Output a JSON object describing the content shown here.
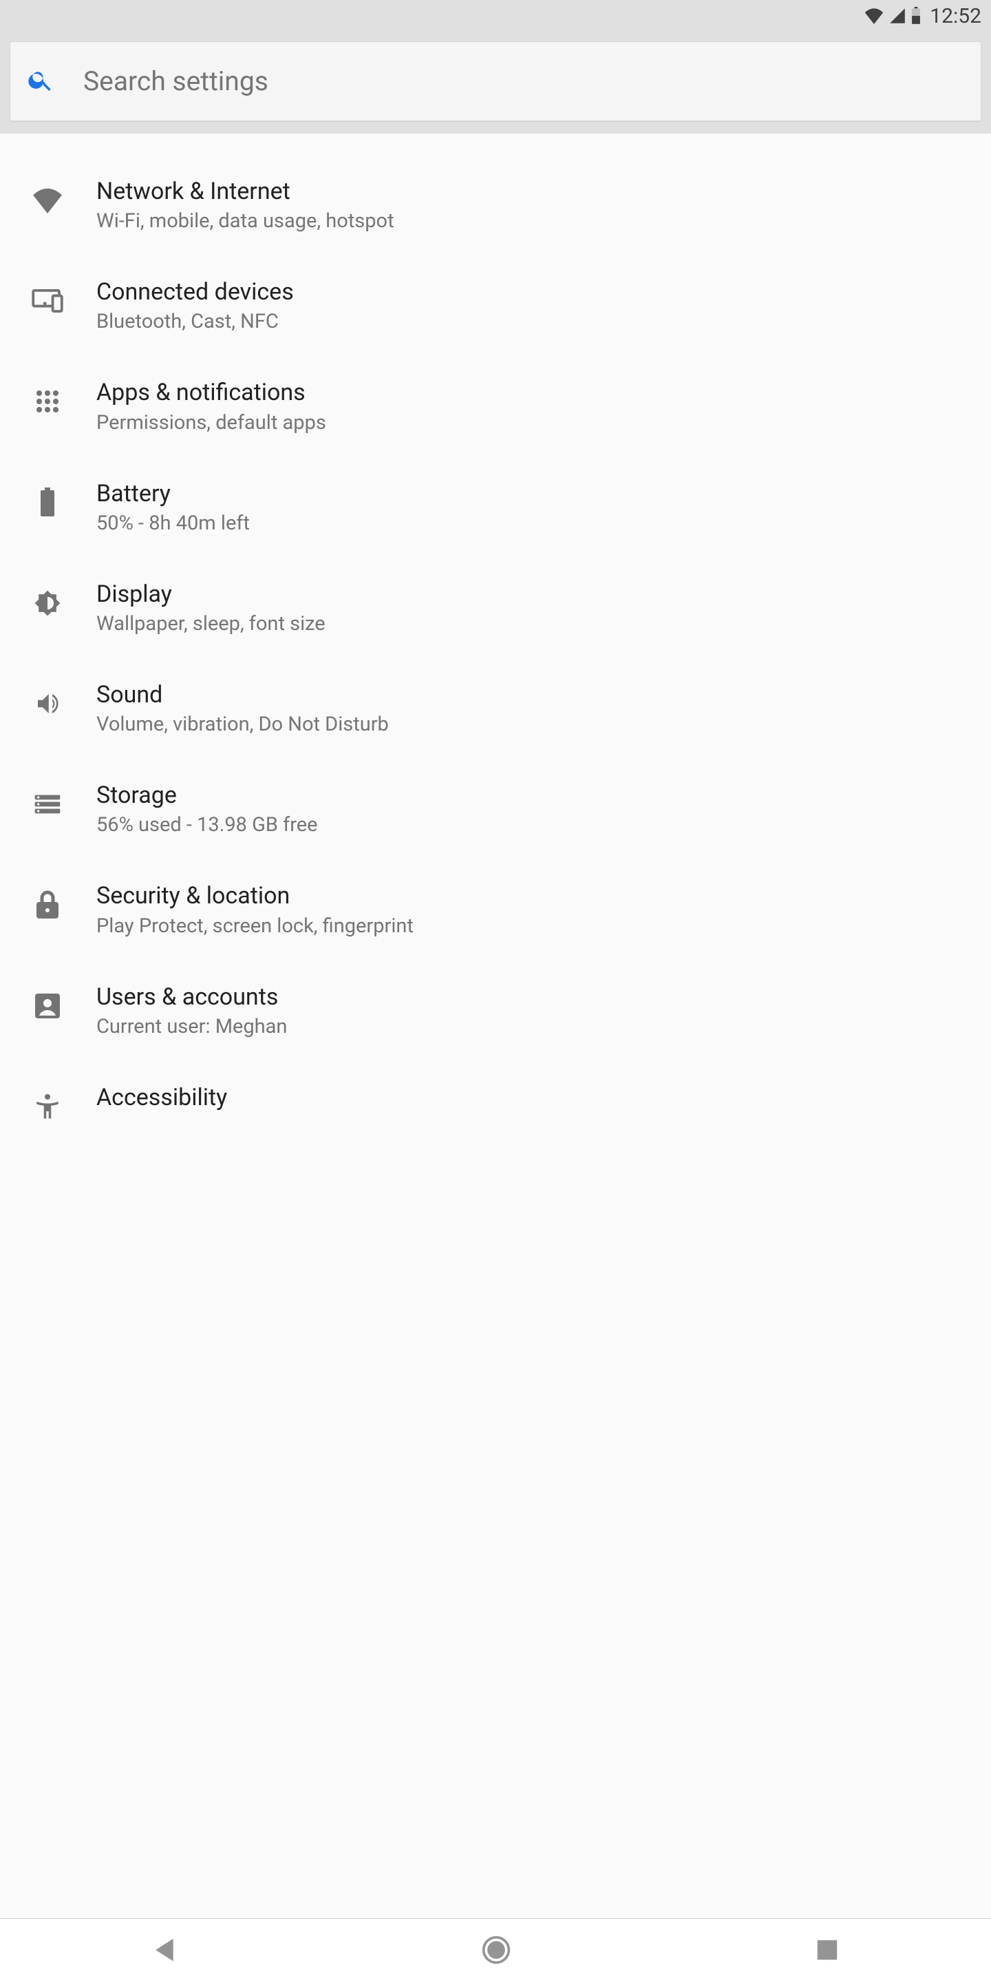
{
  "statusBar": {
    "time": "12:52"
  },
  "search": {
    "placeholder": "Search settings"
  },
  "settings": [
    {
      "id": "network",
      "title": "Network & Internet",
      "subtitle": "Wi-Fi, mobile, data usage, hotspot"
    },
    {
      "id": "connected",
      "title": "Connected devices",
      "subtitle": "Bluetooth, Cast, NFC"
    },
    {
      "id": "apps",
      "title": "Apps & notifications",
      "subtitle": "Permissions, default apps"
    },
    {
      "id": "battery",
      "title": "Battery",
      "subtitle": "50% - 8h 40m left"
    },
    {
      "id": "display",
      "title": "Display",
      "subtitle": "Wallpaper, sleep, font size"
    },
    {
      "id": "sound",
      "title": "Sound",
      "subtitle": "Volume, vibration, Do Not Disturb"
    },
    {
      "id": "storage",
      "title": "Storage",
      "subtitle": "56% used - 13.98 GB free"
    },
    {
      "id": "security",
      "title": "Security & location",
      "subtitle": "Play Protect, screen lock, fingerprint"
    },
    {
      "id": "users",
      "title": "Users & accounts",
      "subtitle": "Current user: Meghan"
    },
    {
      "id": "accessibility",
      "title": "Accessibility",
      "subtitle": ""
    }
  ]
}
